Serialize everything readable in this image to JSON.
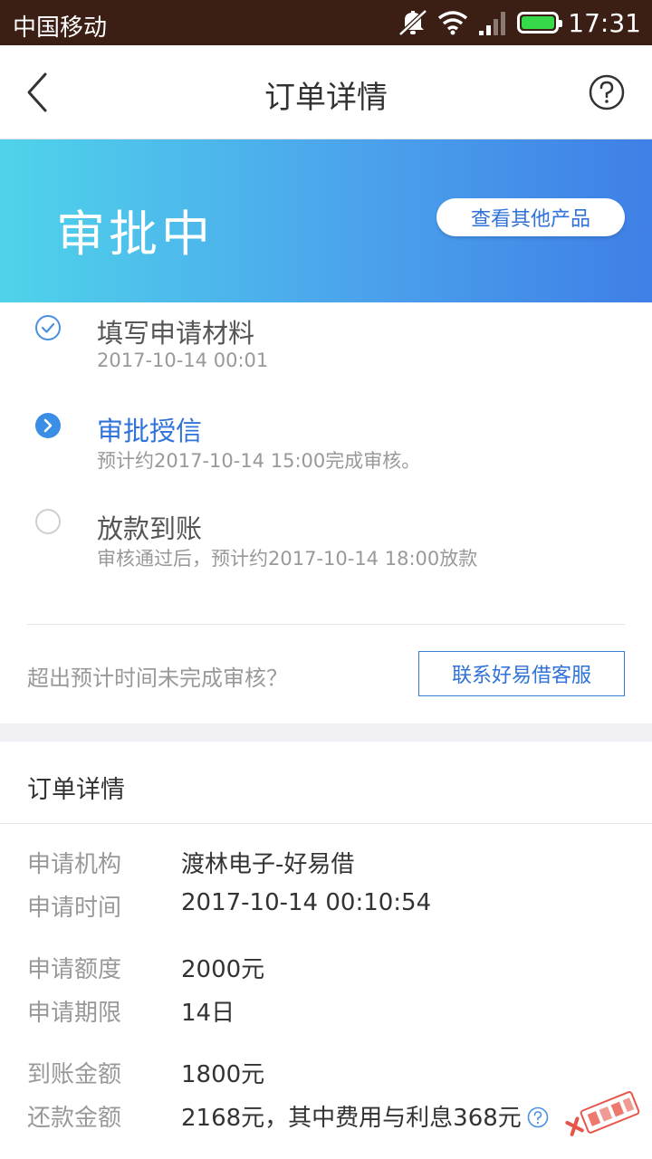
{
  "status_bar": {
    "carrier": "中国移动",
    "time": "17:31",
    "icons": [
      "mute-icon",
      "wifi-icon",
      "signal-icon",
      "battery-icon"
    ]
  },
  "nav": {
    "title": "订单详情",
    "back_icon": "chevron-left-icon",
    "help_icon": "help-circle-icon"
  },
  "hero": {
    "status": "审批中",
    "other_products_label": "查看其他产品"
  },
  "steps": [
    {
      "name": "填写申请材料",
      "sub": "2017-10-14 00:01",
      "state": "done",
      "icon": "check-circle-icon"
    },
    {
      "name": "审批授信",
      "sub": "预计约2017-10-14 15:00完成审核。",
      "state": "active",
      "icon": "arrow-circle-icon"
    },
    {
      "name": "放款到账",
      "sub": "审核通过后，预计约2017-10-14 18:00放款",
      "state": "pending",
      "icon": "empty-circle-icon"
    }
  ],
  "contact": {
    "question": "超出预计时间未完成审核？",
    "button_label": "联系好易借客服"
  },
  "details": {
    "title": "订单详情",
    "rows": [
      {
        "label": "申请机构",
        "value": "渡林电子-好易借"
      },
      {
        "label": "申请时间",
        "value": "2017-10-14 00:10:54"
      },
      {
        "label": "申请额度",
        "value": "2000元"
      },
      {
        "label": "申请期限",
        "value": "14日"
      },
      {
        "label": "到账金额",
        "value": "1800元"
      },
      {
        "label": "还款金额",
        "value": "2168元，其中费用与利息368元"
      }
    ]
  },
  "colors": {
    "accent": "#2f72d9",
    "status_bar": "#3b1f14",
    "hero_start": "#4fd3ea",
    "hero_end": "#3f7fe6"
  }
}
